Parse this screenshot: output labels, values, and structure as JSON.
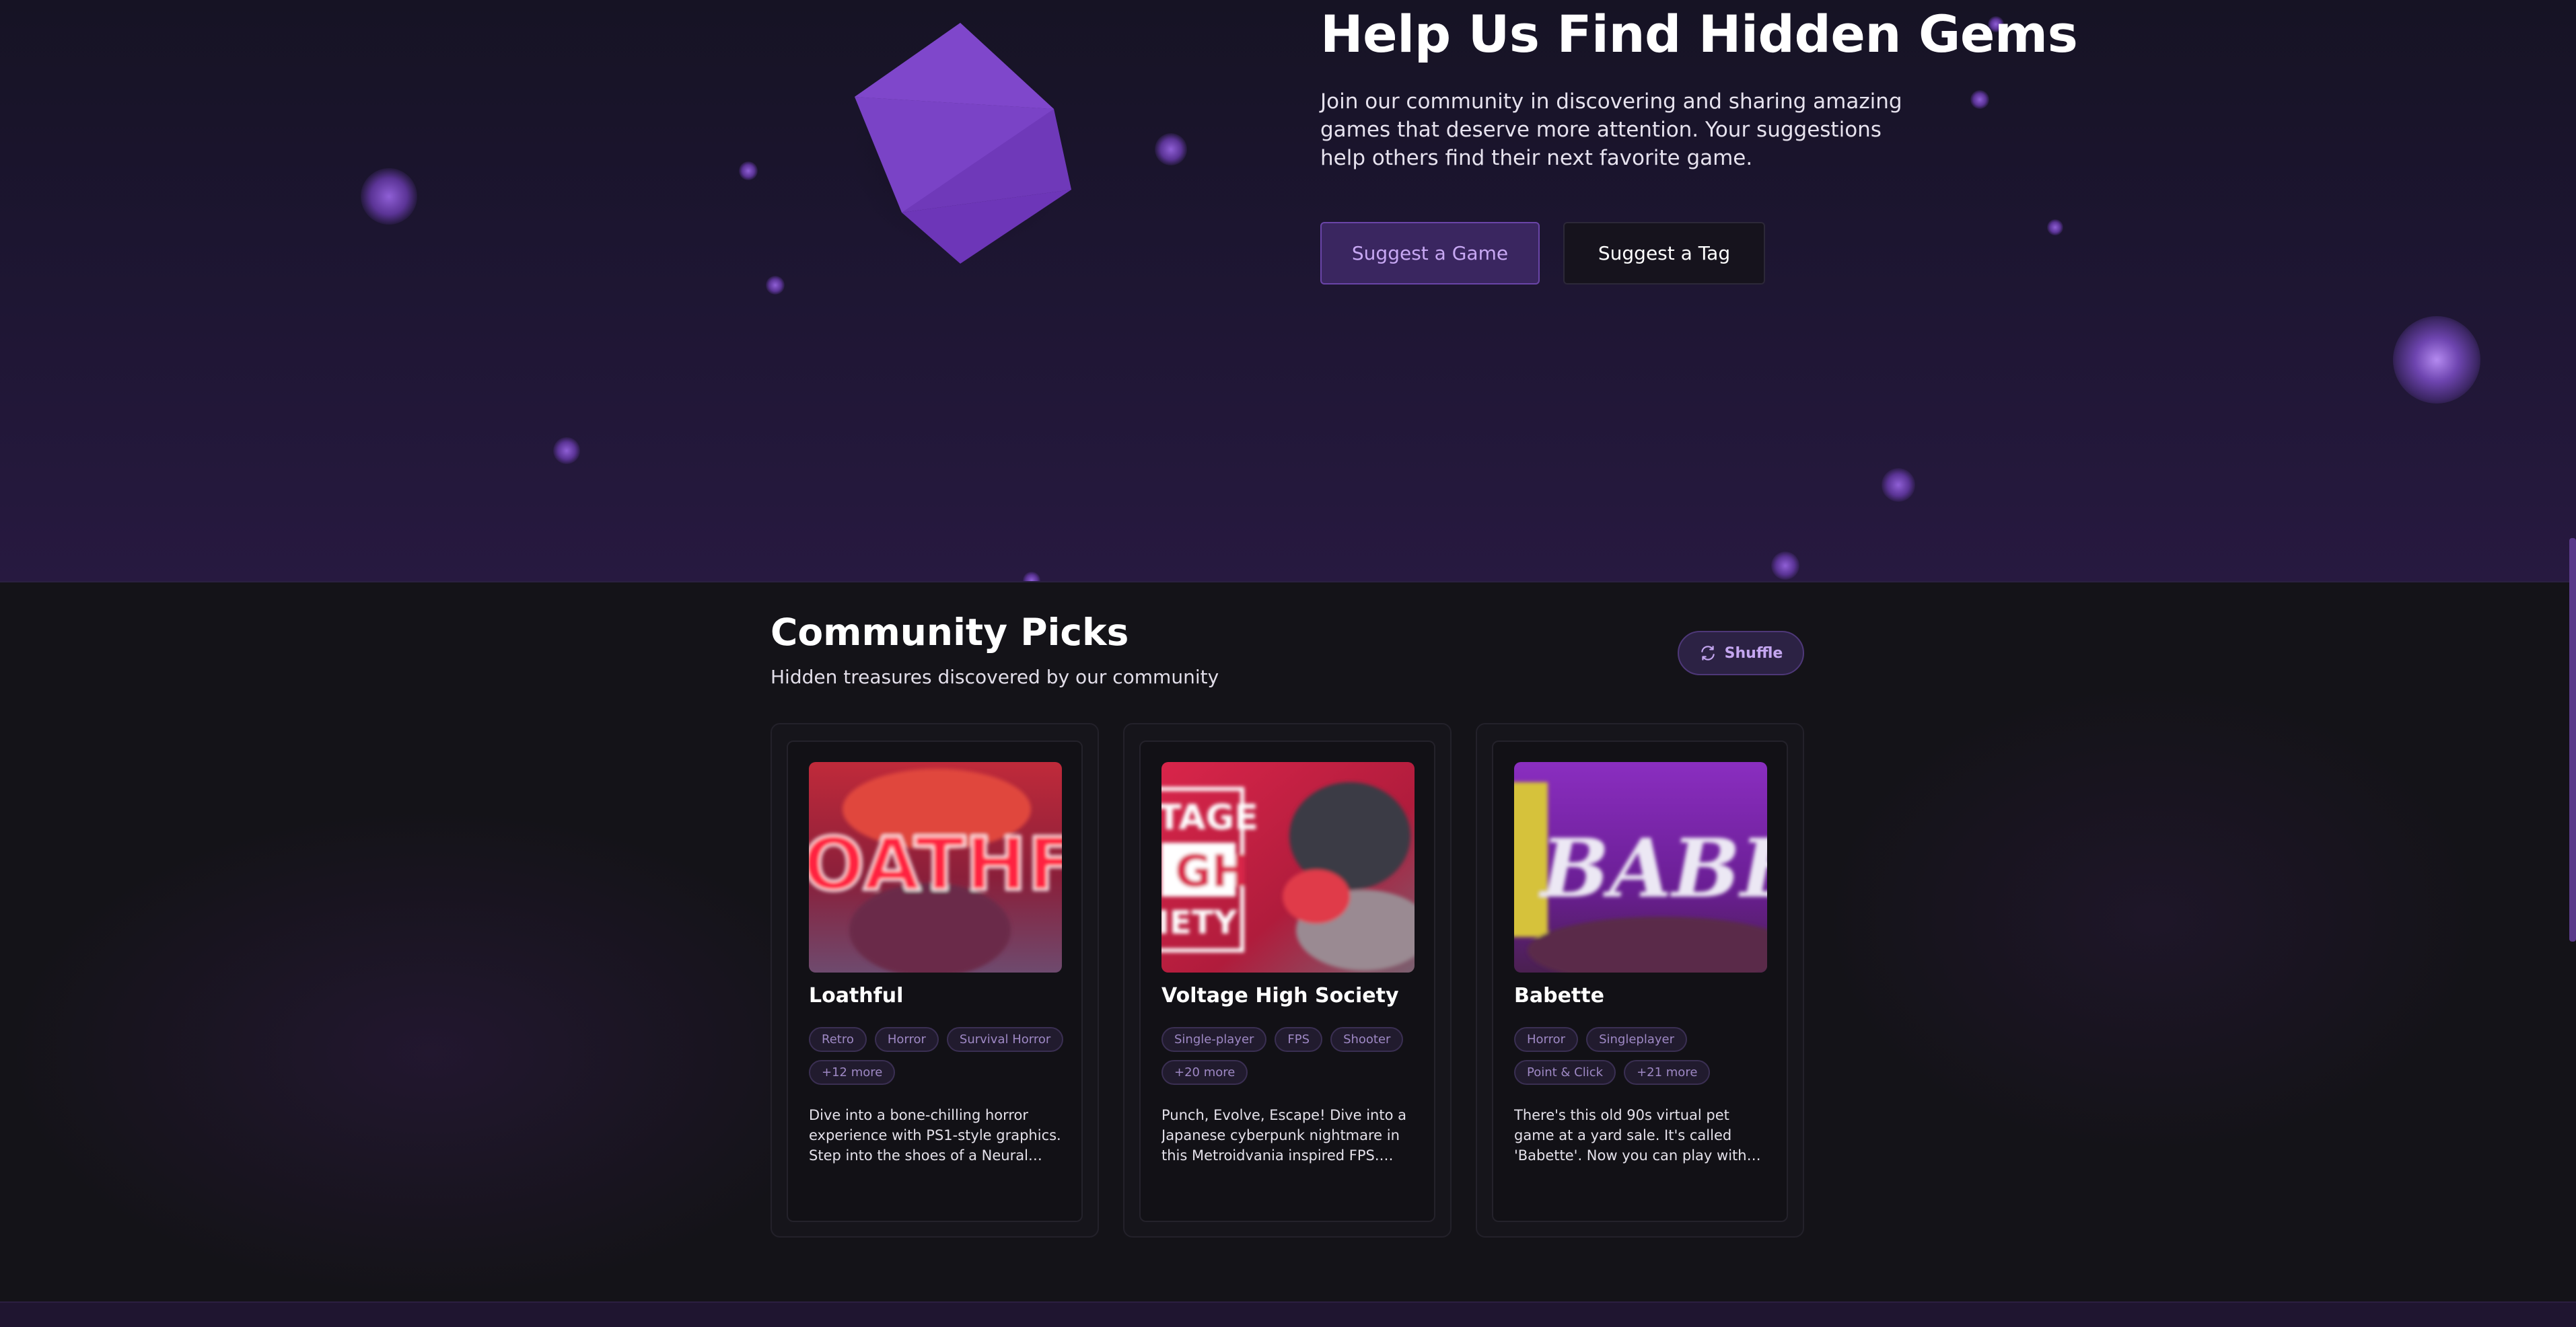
{
  "hero": {
    "title": "Help Us Find Hidden Gems",
    "subtitle": "Join our community in discovering and sharing amazing games that deserve more attention. Your suggestions help others find their next favorite game.",
    "suggest_game_label": "Suggest a Game",
    "suggest_tag_label": "Suggest a Tag",
    "illustration_icon": "cube-icon"
  },
  "community": {
    "title": "Community Picks",
    "subtitle": "Hidden treasures discovered by our community",
    "shuffle_label": "Shuffle",
    "shuffle_icon": "shuffle-icon",
    "cards": [
      {
        "title": "Loathful",
        "tags": [
          "Retro",
          "Horror",
          "Survival Horror",
          "+12 more"
        ],
        "description": "Dive into a bone-chilling horror experience with PS1-style graphics. Step into the shoes of a Neural Net…",
        "thumbnail_text": "OATHFU"
      },
      {
        "title": "Voltage High Society",
        "tags": [
          "Single-player",
          "FPS",
          "Shooter",
          "+20 more"
        ],
        "description": "Punch, Evolve, Escape! Dive into a Japanese cyberpunk nightmare in this Metroidvania inspired FPS. Battle…",
        "thumbnail_text": [
          "TAGE",
          "GH",
          "IETY"
        ]
      },
      {
        "title": "Babette",
        "tags": [
          "Horror",
          "Singleplayer",
          "Point & Click",
          "+21 more"
        ],
        "description": "There's this old 90s virtual pet game at a yard sale. It's called 'Babette'. Now you can play with Babette the cat fro…",
        "thumbnail_text": "BABET"
      }
    ]
  },
  "colors": {
    "accent": "#8b54d6",
    "background": "#141319",
    "hero_background": "#1c1530",
    "tag_text": "#9e88c4"
  }
}
